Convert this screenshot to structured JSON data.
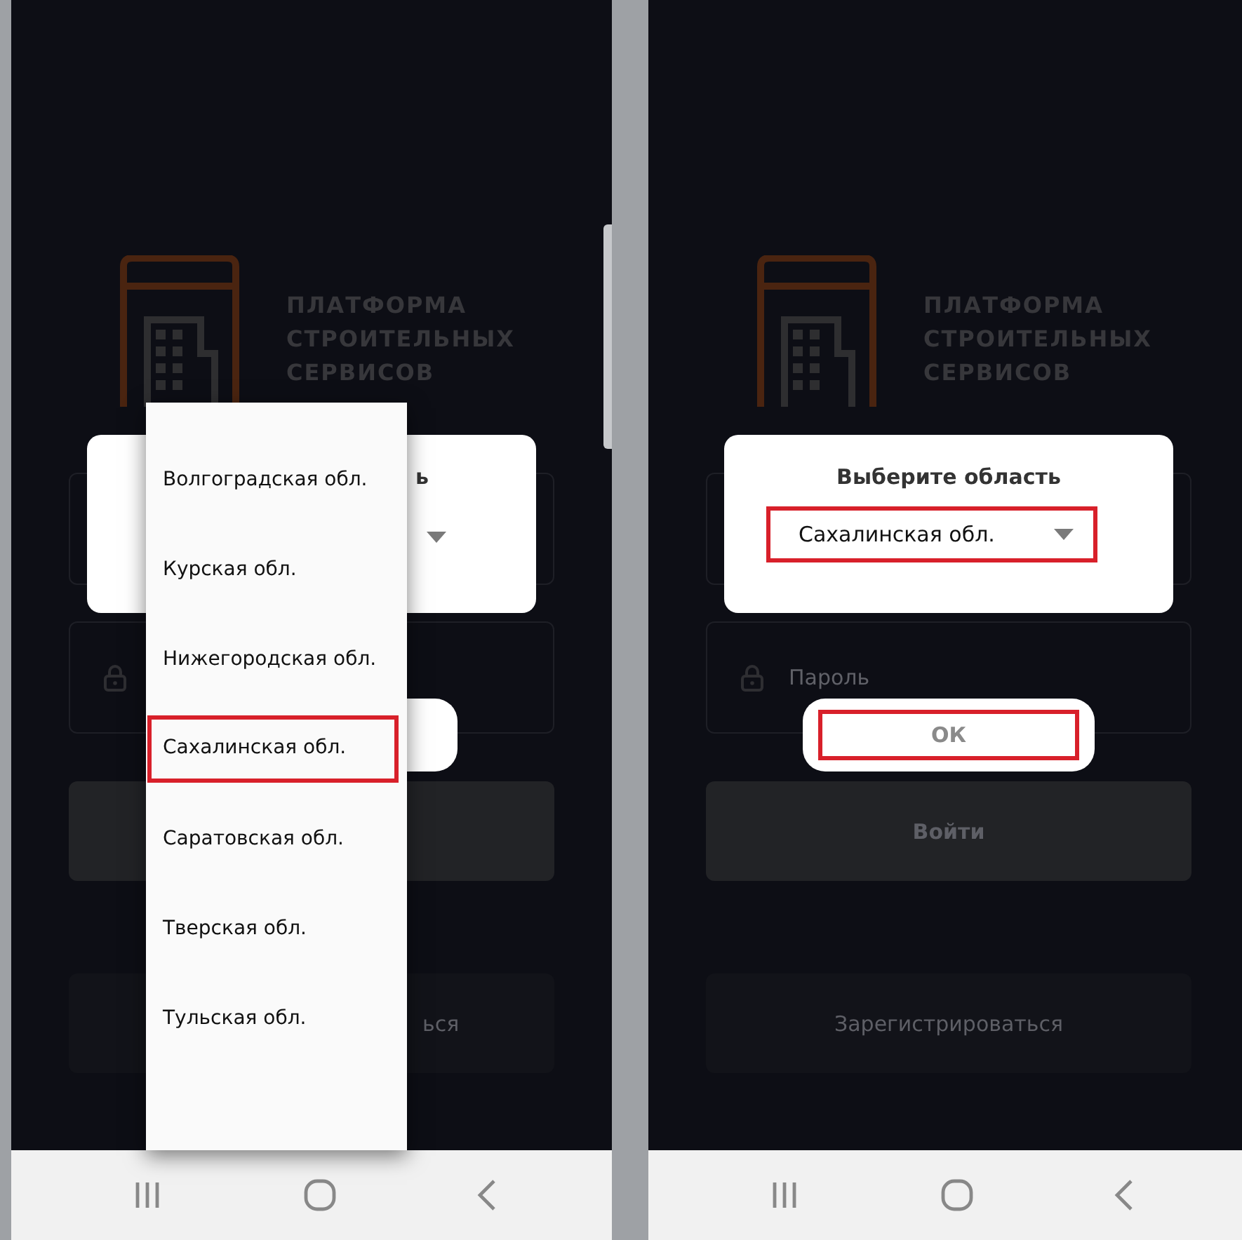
{
  "left_screen": {
    "logo": {
      "lines": [
        "ПЛАТФОРМА",
        "СТРОИТЕЛЬНЫХ",
        "СЕРВИСОВ"
      ]
    },
    "dialog": {
      "title": "ь"
    },
    "register_button": {
      "label": "ься"
    },
    "dropdown": {
      "options": [
        {
          "label": "Волгоградская обл.",
          "selected": false
        },
        {
          "label": "Курская обл.",
          "selected": false
        },
        {
          "label": "Нижегородская обл.",
          "selected": false
        },
        {
          "label": "Сахалинская обл.",
          "selected": true
        },
        {
          "label": "Саратовская обл.",
          "selected": false
        },
        {
          "label": "Тверская обл.",
          "selected": false
        },
        {
          "label": "Тульская обл.",
          "selected": false
        }
      ]
    }
  },
  "right_screen": {
    "logo": {
      "lines": [
        "ПЛАТФОРМА",
        "СТРОИТЕЛЬНЫХ",
        "СЕРВИСОВ"
      ]
    },
    "dialog": {
      "title": "Выберите область",
      "select": {
        "value": "Сахалинская обл.",
        "highlighted": true
      },
      "ok_button": {
        "label": "ОК",
        "highlighted": true
      }
    },
    "password_field": {
      "placeholder": "Пароль"
    },
    "login_button": {
      "label": "Войти"
    },
    "register_button": {
      "label": "Зарегистрироваться"
    }
  }
}
